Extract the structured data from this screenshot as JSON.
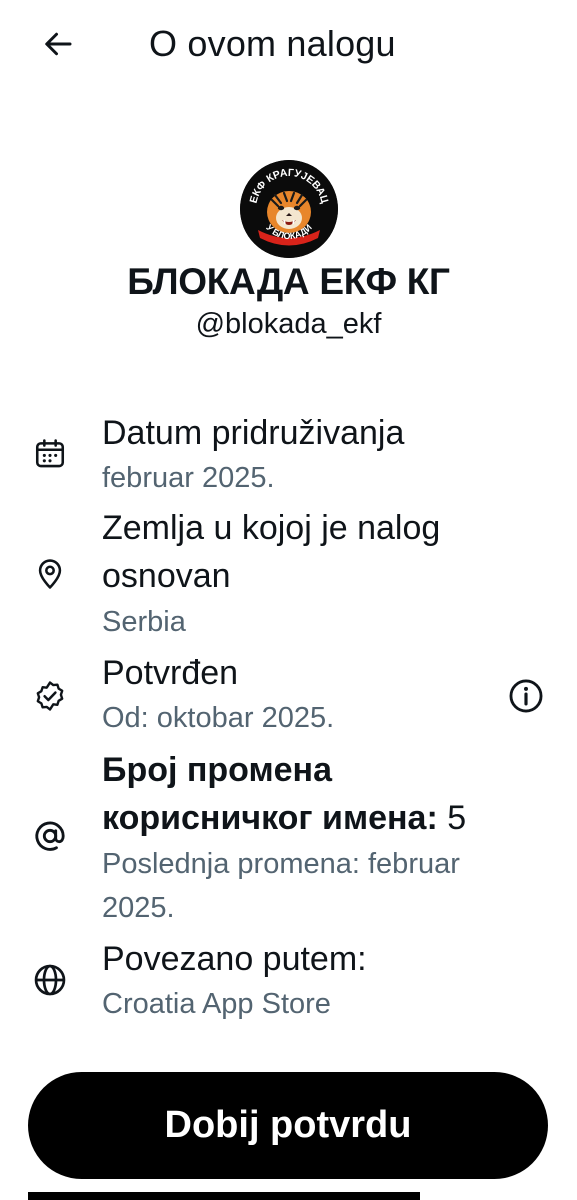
{
  "header": {
    "title": "O ovom nalogu",
    "back_icon": "arrow-left-icon"
  },
  "profile": {
    "avatar_ring_text_top": "ЕКФ КРАГУЈЕВАЦ",
    "avatar_ring_text_bottom": "У БЛОКАДИ",
    "display_name": "БЛОКАДА ЕКФ КГ",
    "handle": "@blokada_ekf"
  },
  "details": {
    "joined": {
      "icon": "calendar-icon",
      "label": "Datum pridruživanja",
      "value": "februar 2025."
    },
    "country": {
      "icon": "location-pin-icon",
      "label_line1": "Zemlja u kojoj je nalog",
      "label_line2": "osnovan",
      "value": "Serbia"
    },
    "verified": {
      "icon": "verified-badge-icon",
      "label": "Potvrđen",
      "value": "Od: oktobar 2025.",
      "info_icon": "info-icon"
    },
    "username_changes": {
      "icon": "at-sign-icon",
      "label_line1": "Број промена",
      "label_line2": "корисничког имена:",
      "count": "5",
      "value_line1": "Poslednja promena: februar",
      "value_line2": "2025."
    },
    "connected_via": {
      "icon": "globe-icon",
      "label": "Povezano putem:",
      "value": "Croatia App Store"
    }
  },
  "cta": {
    "label": "Dobij potvrdu"
  },
  "colors": {
    "text_primary": "#0f1419",
    "text_secondary": "#536471",
    "button_bg": "#000000",
    "button_text": "#ffffff",
    "avatar_bg": "#0b0b0b",
    "avatar_ribbon": "#d8231a"
  }
}
